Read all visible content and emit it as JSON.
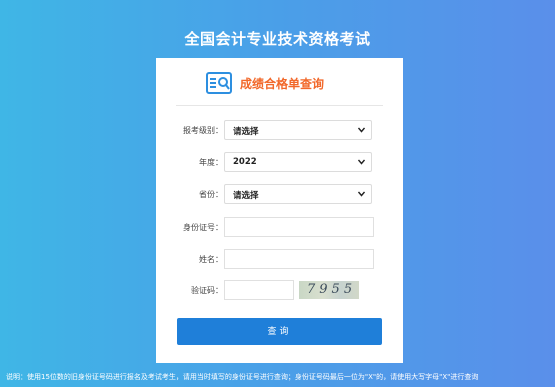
{
  "page": {
    "title": "全国会计专业技术资格考试"
  },
  "panel": {
    "heading": "成绩合格单查询"
  },
  "form": {
    "exam_level": {
      "label": "报考级别：",
      "value": "请选择"
    },
    "year": {
      "label": "年度：",
      "value": "2022"
    },
    "province": {
      "label": "省份：",
      "value": "请选择"
    },
    "id_number": {
      "label": "身份证号：",
      "value": ""
    },
    "name": {
      "label": "姓名：",
      "value": ""
    },
    "captcha": {
      "label": "验证码：",
      "value": "",
      "image_text": "7955"
    },
    "submit_label": "查询"
  },
  "footnote": "说明：使用15位数的旧身份证号码进行报名及考试考生，请用当时填写的身份证号进行查询；身份证号码最后一位为\"X\"的，请使用大写字母\"X\"进行查询",
  "colors": {
    "accent": "#1f7fd9",
    "heading": "#f2682a"
  }
}
